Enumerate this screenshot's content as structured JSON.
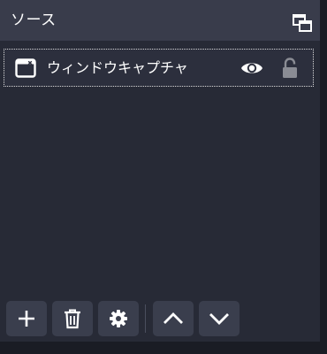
{
  "dock": {
    "title": "ソース"
  },
  "sources": {
    "items": [
      {
        "label": "ウィンドウキャプチャ",
        "icon": "window-capture-icon",
        "visible": true,
        "locked": false
      }
    ]
  },
  "toolbar": {
    "buttons": [
      {
        "name": "add-source-button",
        "icon": "plus-icon"
      },
      {
        "name": "remove-source-button",
        "icon": "trash-icon"
      },
      {
        "name": "source-properties-button",
        "icon": "gear-icon"
      },
      {
        "name": "move-up-button",
        "icon": "chevron-up-icon"
      },
      {
        "name": "move-down-button",
        "icon": "chevron-down-icon"
      }
    ]
  },
  "colors": {
    "panel_bg": "#272a36",
    "header_bg": "#393c4b",
    "button_bg": "#3a3e4d",
    "text": "#ffffff",
    "lock_icon": "#8a8c94"
  }
}
